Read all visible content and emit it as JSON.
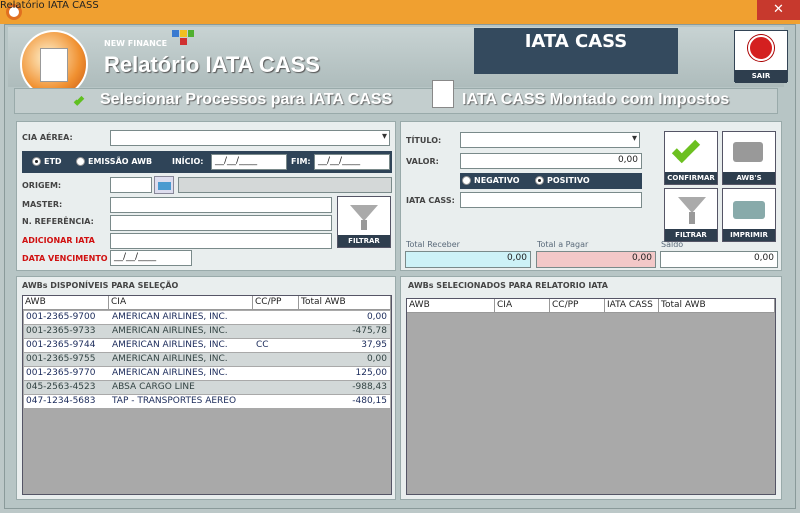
{
  "window": {
    "title": "Relatório IATA CASS",
    "close": "✕"
  },
  "header": {
    "brand": "NEW FINANCE",
    "title": "Relatório IATA CASS",
    "banner": "IATA CASS",
    "exit_label": "SAIR"
  },
  "sections": {
    "left": "Selecionar Processos para IATA CASS",
    "right": "IATA CASS Montado com Impostos"
  },
  "form": {
    "cia_label": "CIA AÉREA:",
    "cia_value": "",
    "etd_label": "ETD",
    "emissao_label": "EMISSÃO AWB",
    "inicio_label": "INÍCIO:",
    "inicio_value": "__/__/____",
    "fim_label": "FIM:",
    "fim_value": "__/__/____",
    "origem_label": "ORIGEM:",
    "master_label": "MASTER:",
    "nref_label": "N. REFERÊNCIA:",
    "adicionar_label": "ADICIONAR IATA",
    "vencimento_label": "DATA VENCIMENTO",
    "vencimento_value": "__/__/____",
    "filtrar_label": "FILTRAR"
  },
  "right_form": {
    "titulo_label": "TÍTULO:",
    "valor_label": "VALOR:",
    "valor_value": "0,00",
    "negativo_label": "NEGATIVO",
    "positivo_label": "POSITIVO",
    "iata_cass_label": "IATA CASS:",
    "total_receber_label": "Total Receber",
    "total_receber_value": "0,00",
    "total_pagar_label": "Total a Pagar",
    "total_pagar_value": "0,00",
    "saldo_label": "Saldo",
    "saldo_value": "0,00"
  },
  "buttons": {
    "confirmar": "CONFIRMAR",
    "awbs": "AWB'S",
    "filtrar": "FILTRAR",
    "imprimir": "IMPRIMIR"
  },
  "available": {
    "title": "AWBs DISPONÍVEIS PARA SELEÇÃO",
    "columns": [
      "AWB",
      "CIA",
      "CC/PP",
      "Total AWB"
    ],
    "rows": [
      [
        "001-2365-9700",
        "AMERICAN AIRLINES, INC.",
        "",
        "0,00"
      ],
      [
        "001-2365-9733",
        "AMERICAN AIRLINES, INC.",
        "",
        "-475,78"
      ],
      [
        "001-2365-9744",
        "AMERICAN AIRLINES, INC.",
        "CC",
        "37,95"
      ],
      [
        "001-2365-9755",
        "AMERICAN AIRLINES, INC.",
        "",
        "0,00"
      ],
      [
        "001-2365-9770",
        "AMERICAN AIRLINES, INC.",
        "",
        "125,00"
      ],
      [
        "045-2563-4523",
        "ABSA CARGO LINE",
        "",
        "-988,43"
      ],
      [
        "047-1234-5683",
        "TAP - TRANSPORTES AEREO",
        "",
        "-480,15"
      ]
    ]
  },
  "selected": {
    "title": "AWBs SELECIONADOS PARA RELATORIO IATA",
    "columns": [
      "AWB",
      "CIA",
      "CC/PP",
      "IATA CASS",
      "Total AWB"
    ]
  }
}
